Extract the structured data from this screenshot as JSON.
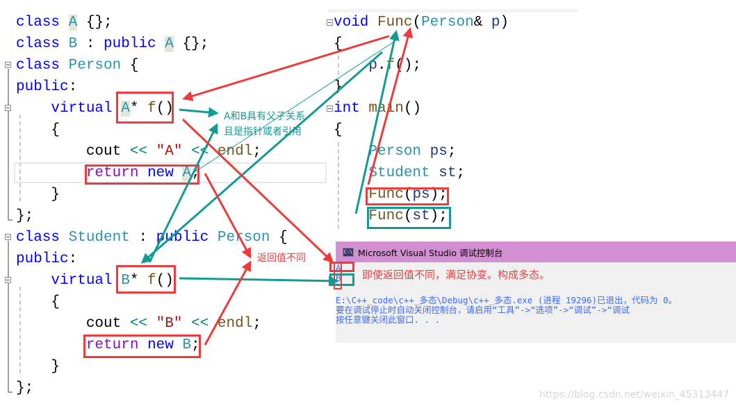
{
  "left_code": {
    "lines": [
      {
        "tokens": [
          [
            "kw",
            "class"
          ],
          [
            "",
            "",
            " "
          ],
          [
            "ty hl",
            "A"
          ],
          [
            "",
            " {};"
          ]
        ]
      },
      {
        "tokens": [
          [
            "kw",
            "class"
          ],
          [
            "",
            " "
          ],
          [
            "ty",
            "B"
          ],
          [
            "",
            " : "
          ],
          [
            "kw",
            "public"
          ],
          [
            "",
            " "
          ],
          [
            "ty hl",
            "A"
          ],
          [
            "",
            " {};"
          ]
        ]
      },
      {
        "tokens": [
          [
            "kw",
            "class"
          ],
          [
            "",
            " "
          ],
          [
            "ty",
            "Person"
          ],
          [
            "",
            " {"
          ]
        ]
      },
      {
        "tokens": [
          [
            "kw",
            "public"
          ],
          [
            "",
            ":"
          ]
        ]
      },
      {
        "tokens": [
          [
            "",
            "    "
          ],
          [
            "kw",
            "virtual"
          ],
          [
            "",
            " "
          ],
          [
            "ty hl",
            "A"
          ],
          [
            "",
            "* "
          ],
          [
            "fn",
            "f"
          ],
          [
            "",
            "()"
          ]
        ]
      },
      {
        "tokens": [
          [
            "",
            "    {"
          ]
        ]
      },
      {
        "tokens": [
          [
            "",
            "        cout "
          ],
          [
            "op",
            "<<"
          ],
          [
            "",
            " "
          ],
          [
            "str",
            "\"A\""
          ],
          [
            "",
            " "
          ],
          [
            "op",
            "<<"
          ],
          [
            "",
            " "
          ],
          [
            "fn",
            "endl"
          ],
          [
            "",
            ";"
          ]
        ]
      },
      {
        "tokens": [
          [
            "",
            "        "
          ],
          [
            "ret",
            "return"
          ],
          [
            "",
            " "
          ],
          [
            "kw",
            "new"
          ],
          [
            "",
            " "
          ],
          [
            "ty hl",
            "A"
          ],
          [
            "",
            ";"
          ]
        ]
      },
      {
        "tokens": [
          [
            "",
            "    }"
          ]
        ]
      },
      {
        "tokens": [
          [
            "",
            "};"
          ]
        ]
      },
      {
        "tokens": [
          [
            "kw",
            "class"
          ],
          [
            "",
            " "
          ],
          [
            "ty",
            "Student"
          ],
          [
            "",
            " : "
          ],
          [
            "kw",
            "public"
          ],
          [
            "",
            " "
          ],
          [
            "ty",
            "Person"
          ],
          [
            "",
            " {"
          ]
        ]
      },
      {
        "tokens": [
          [
            "kw",
            "public"
          ],
          [
            "",
            ":"
          ]
        ]
      },
      {
        "tokens": [
          [
            "",
            "    "
          ],
          [
            "kw",
            "virtual"
          ],
          [
            "",
            " "
          ],
          [
            "ty",
            "B"
          ],
          [
            "",
            "* "
          ],
          [
            "fn",
            "f"
          ],
          [
            "",
            "()"
          ]
        ]
      },
      {
        "tokens": [
          [
            "",
            "    {"
          ]
        ]
      },
      {
        "tokens": [
          [
            "",
            "        cout "
          ],
          [
            "op",
            "<<"
          ],
          [
            "",
            " "
          ],
          [
            "str",
            "\"B\""
          ],
          [
            "",
            " "
          ],
          [
            "op",
            "<<"
          ],
          [
            "",
            " "
          ],
          [
            "fn",
            "endl"
          ],
          [
            "",
            ";"
          ]
        ]
      },
      {
        "tokens": [
          [
            "",
            "        "
          ],
          [
            "ret",
            "return"
          ],
          [
            "",
            " "
          ],
          [
            "kw",
            "new"
          ],
          [
            "",
            " "
          ],
          [
            "ty",
            "B"
          ],
          [
            "",
            ";"
          ]
        ]
      },
      {
        "tokens": [
          [
            "",
            "    }"
          ]
        ]
      },
      {
        "tokens": [
          [
            "",
            "};"
          ]
        ]
      }
    ]
  },
  "right_code": {
    "lines": [
      {
        "tokens": [
          [
            "kw",
            "void"
          ],
          [
            "",
            " "
          ],
          [
            "fn",
            "Func"
          ],
          [
            "",
            "("
          ],
          [
            "ty",
            "Person"
          ],
          [
            "",
            "& "
          ],
          [
            "par",
            "p"
          ],
          [
            "",
            ")"
          ]
        ]
      },
      {
        "tokens": [
          [
            "",
            "{"
          ]
        ]
      },
      {
        "tokens": [
          [
            "",
            "    "
          ],
          [
            "par",
            "p"
          ],
          [
            "",
            "."
          ],
          [
            "fn",
            "f"
          ],
          [
            "",
            "();"
          ]
        ]
      },
      {
        "tokens": [
          [
            "",
            "}"
          ]
        ]
      },
      {
        "tokens": [
          [
            "kw",
            "int"
          ],
          [
            "",
            " "
          ],
          [
            "fn",
            "main"
          ],
          [
            "",
            "()"
          ]
        ]
      },
      {
        "tokens": [
          [
            "",
            "{"
          ]
        ]
      },
      {
        "tokens": [
          [
            "",
            "    "
          ],
          [
            "ty",
            "Person"
          ],
          [
            "",
            " "
          ],
          [
            "par",
            "ps"
          ],
          [
            "",
            ";"
          ]
        ]
      },
      {
        "tokens": [
          [
            "",
            "    "
          ],
          [
            "ty",
            "Student"
          ],
          [
            "",
            " "
          ],
          [
            "par",
            "st"
          ],
          [
            "",
            ";"
          ]
        ]
      },
      {
        "tokens": [
          [
            "",
            "    "
          ],
          [
            "fn",
            "Func"
          ],
          [
            "",
            "("
          ],
          [
            "par",
            "ps"
          ],
          [
            "",
            ");"
          ]
        ]
      },
      {
        "tokens": [
          [
            "",
            "    "
          ],
          [
            "fn",
            "Func"
          ],
          [
            "",
            "("
          ],
          [
            "par",
            "st"
          ],
          [
            "",
            ");"
          ]
        ]
      }
    ]
  },
  "annotations": {
    "relation_note_line1": "A和B具有父子关系",
    "relation_note_line2": "且是指针或者引用",
    "return_diff_note": "返回值不同",
    "covariance_note": "即使返回值不同，满足协变。构成多态。"
  },
  "console": {
    "title": "Microsoft Visual Studio 调试控制台",
    "icon_label": "C:\\",
    "output_lines": [
      "A",
      "B"
    ],
    "exit_message": "E:\\C++_code\\c++_多态\\Debug\\c++_多态.exe (进程 19296)已退出，代码为 0。",
    "hint_message": "要在调试停止时自动关闭控制台，请启用“工具”->“选项”->“调试”->“调试",
    "press_key_message": "按任意键关闭此窗口. . ."
  },
  "watermark": "https://blog.csdn.net/weixin_45313447",
  "colors": {
    "annotation_red": "#ee3a3a",
    "annotation_teal": "#129a94",
    "console_title_bg": "#d28fd2",
    "console_text": "#3a6aff"
  }
}
